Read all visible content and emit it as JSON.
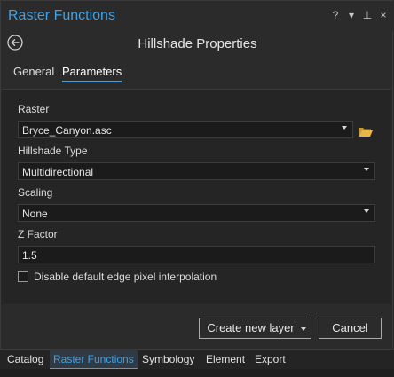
{
  "pane": {
    "title": "Raster Functions",
    "controls": {
      "help": "?",
      "menu": "▾",
      "pin": "⊥",
      "close": "×"
    }
  },
  "header": {
    "title": "Hillshade Properties"
  },
  "tabs": [
    {
      "label": "General",
      "active": false
    },
    {
      "label": "Parameters",
      "active": true
    }
  ],
  "fields": {
    "raster": {
      "label": "Raster",
      "value": "Bryce_Canyon.asc"
    },
    "hillshade_type": {
      "label": "Hillshade Type",
      "value": "Multidirectional"
    },
    "scaling": {
      "label": "Scaling",
      "value": "None"
    },
    "z_factor": {
      "label": "Z Factor",
      "value": "1.5"
    },
    "edge_interp": {
      "label": "Disable default edge pixel interpolation",
      "checked": false
    }
  },
  "buttons": {
    "create": "Create new layer",
    "cancel": "Cancel"
  },
  "bottom_tabs": [
    {
      "label": "Catalog",
      "active": false
    },
    {
      "label": "Raster Functions",
      "active": true
    },
    {
      "label": "Symbology",
      "active": false
    },
    {
      "label": "Element",
      "active": false
    },
    {
      "label": "Export",
      "active": false
    }
  ],
  "colors": {
    "accent": "#3fa3e6",
    "folder": "#e8b64a"
  }
}
